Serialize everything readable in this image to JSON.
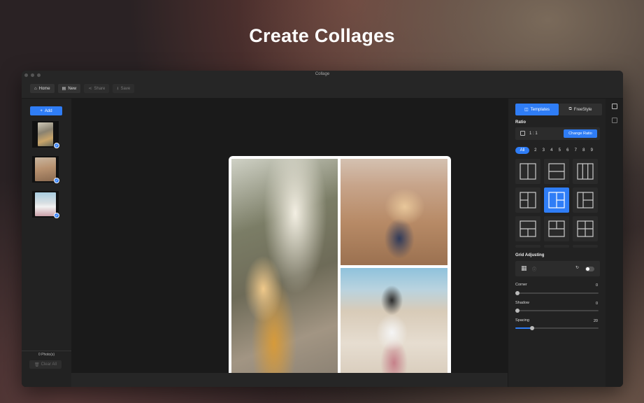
{
  "hero": {
    "title": "Create Collages"
  },
  "window": {
    "title": "Collage"
  },
  "toolbar": {
    "home": "Home",
    "new": "New",
    "share": "Share",
    "save": "Save"
  },
  "left_panel": {
    "add_label": "Add",
    "photo_count": "0 Photo(s)",
    "clear_label": "Clear All"
  },
  "right_panel": {
    "tabs": {
      "templates": "Templates",
      "freestyle": "FreeStyle"
    },
    "ratio_heading": "Ratio",
    "ratio_value": "1 : 1",
    "change_ratio": "Change Ratio",
    "counts": {
      "all": "All",
      "n2": "2",
      "n3": "3",
      "n4": "4",
      "n5": "5",
      "n6": "6",
      "n7": "7",
      "n8": "8",
      "n9": "9"
    },
    "grid_adjusting": "Grid Adjusting",
    "corner_label": "Corner",
    "corner_value": "0",
    "shadow_label": "Shadow",
    "shadow_value": "0",
    "spacing_label": "Spacing",
    "spacing_value": "20"
  },
  "colors": {
    "accent": "#2f7df6",
    "panel": "#222222",
    "canvas": "#1a1a1a"
  },
  "sliders": {
    "corner": 0,
    "shadow": 0,
    "spacing": 0.2
  }
}
